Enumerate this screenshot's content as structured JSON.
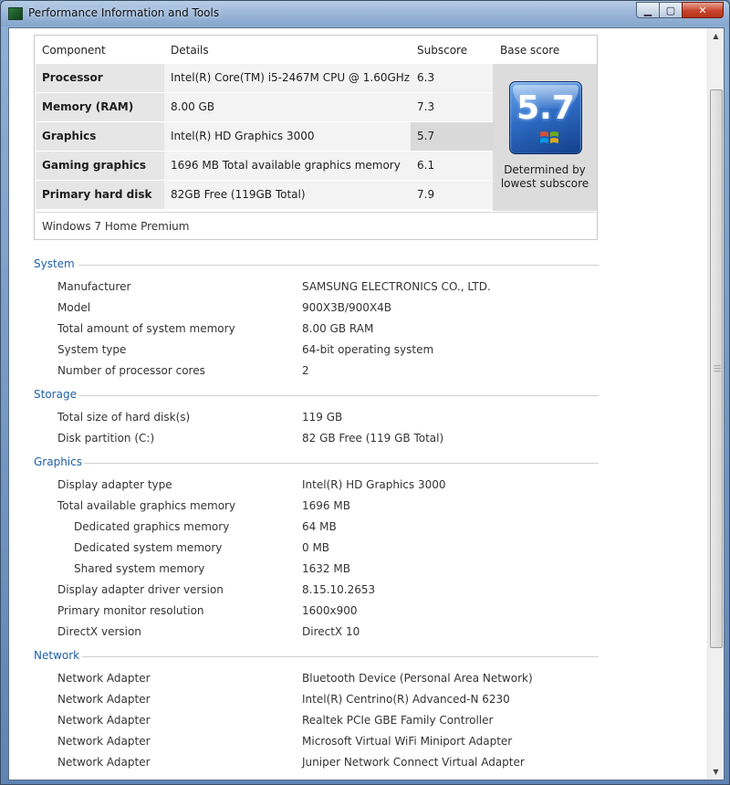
{
  "window": {
    "title": "Performance Information and Tools"
  },
  "score_table": {
    "headers": {
      "component": "Component",
      "details": "Details",
      "subscore": "Subscore",
      "base": "Base score"
    },
    "rows": [
      {
        "component": "Processor",
        "details": "Intel(R) Core(TM) i5-2467M CPU @ 1.60GHz",
        "subscore": "6.3"
      },
      {
        "component": "Memory (RAM)",
        "details": "8.00 GB",
        "subscore": "7.3"
      },
      {
        "component": "Graphics",
        "details": "Intel(R) HD Graphics 3000",
        "subscore": "5.7"
      },
      {
        "component": "Gaming graphics",
        "details": "1696 MB Total available graphics memory",
        "subscore": "6.1"
      },
      {
        "component": "Primary hard disk",
        "details": "82GB Free (119GB Total)",
        "subscore": "7.9"
      }
    ],
    "base_score": "5.7",
    "base_caption_line1": "Determined by",
    "base_caption_line2": "lowest subscore",
    "edition": "Windows 7 Home Premium"
  },
  "sections": {
    "system": {
      "title": "System",
      "items": [
        {
          "label": "Manufacturer",
          "value": "SAMSUNG ELECTRONICS CO., LTD."
        },
        {
          "label": "Model",
          "value": "900X3B/900X4B"
        },
        {
          "label": "Total amount of system memory",
          "value": "8.00 GB RAM"
        },
        {
          "label": "System type",
          "value": "64-bit operating system"
        },
        {
          "label": "Number of processor cores",
          "value": "2"
        }
      ]
    },
    "storage": {
      "title": "Storage",
      "items": [
        {
          "label": "Total size of hard disk(s)",
          "value": "119 GB"
        },
        {
          "label": "Disk partition (C:)",
          "value": "82 GB Free (119 GB Total)"
        }
      ]
    },
    "graphics": {
      "title": "Graphics",
      "items": [
        {
          "label": "Display adapter type",
          "value": "Intel(R) HD Graphics 3000"
        },
        {
          "label": "Total available graphics memory",
          "value": "1696 MB"
        },
        {
          "label": "Dedicated graphics memory",
          "value": "64 MB"
        },
        {
          "label": "Dedicated system memory",
          "value": "0 MB"
        },
        {
          "label": "Shared system memory",
          "value": "1632 MB"
        },
        {
          "label": "Display adapter driver version",
          "value": "8.15.10.2653"
        },
        {
          "label": "Primary monitor resolution",
          "value": "1600x900"
        },
        {
          "label": "DirectX version",
          "value": "DirectX 10"
        }
      ]
    },
    "network": {
      "title": "Network",
      "items": [
        {
          "label": "Network Adapter",
          "value": "Bluetooth Device (Personal Area Network)"
        },
        {
          "label": "Network Adapter",
          "value": "Intel(R) Centrino(R) Advanced-N 6230"
        },
        {
          "label": "Network Adapter",
          "value": "Realtek PCIe GBE Family Controller"
        },
        {
          "label": "Network Adapter",
          "value": "Microsoft Virtual WiFi Miniport Adapter"
        },
        {
          "label": "Network Adapter",
          "value": "Juniper Network Connect Virtual Adapter"
        }
      ]
    }
  },
  "colors": {
    "section_title": "#1e5fa8",
    "badge": "#2e6cc4",
    "close_button": "#c8442c"
  },
  "icons": {
    "app": "performance-icon",
    "badge": "windows-flag-icon"
  }
}
